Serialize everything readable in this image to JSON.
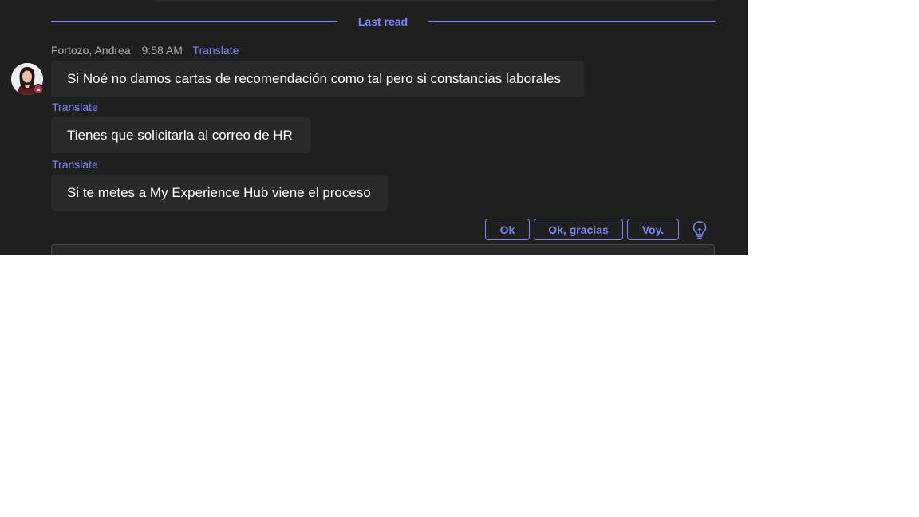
{
  "divider": {
    "last_read_label": "Last read"
  },
  "message_group": {
    "sender": "Fortozo, Andrea",
    "time": "9:58 AM",
    "translate_label": "Translate",
    "messages": [
      {
        "text": "Si Noé no damos cartas de recomendación como tal pero si constancias laborales",
        "translate_label": "Translate"
      },
      {
        "text": "Tienes que solicitarla al correo de HR",
        "translate_label": "Translate"
      },
      {
        "text": "Si te metes a My Experience Hub viene el proceso",
        "translate_label": "Translate"
      }
    ],
    "presence_status": "do-not-disturb"
  },
  "suggested_replies": [
    "Ok",
    "Ok, gracias",
    "Voy."
  ],
  "icons": {
    "suggestions": "lightbulb-icon",
    "presence": "presence-dnd-icon"
  },
  "colors": {
    "background": "#1f1f1f",
    "bubble": "#292929",
    "accent": "#7f85f5",
    "meta_text": "#adadad",
    "dnd": "#c4314b"
  }
}
